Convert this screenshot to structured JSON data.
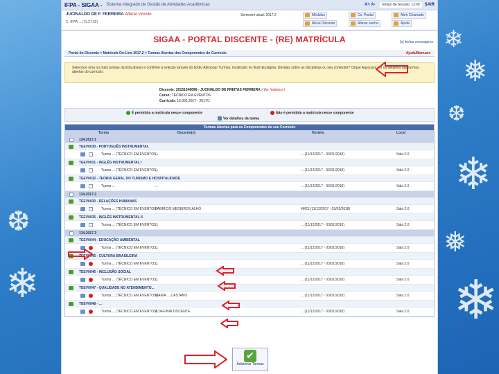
{
  "topbar": {
    "app_name": "IFPA - SIGAA -",
    "system_name": "Sistema Integrado de Gestão de Atividades Acadêmicas",
    "font_controls": "A+ A-",
    "session_timer": "Tempo de Sessão: 1x:00",
    "logout": "SAIR",
    "user_name": "JUCINALDO DE F. FERREIRA",
    "change_link": "Alterar vínculo",
    "user_sub": "C. IFPA ... (11.27.02)",
    "semester": "Semestre atual: 2017.2"
  },
  "toolbar": {
    "modules": "Módulos",
    "inbox": "Cx. Postal",
    "support": "Abrir Chamado",
    "menu": "Menu Discente",
    "password": "Alterar senha",
    "help": "Ajuda"
  },
  "heading": "SIGAA - PORTAL DISCENTE - (RE) MATRÍCULA",
  "close_messages": "[x] fechar mensagens",
  "breadcrumb": "Portal do Discente > Matrícula On-Line 2017.2 > Turmas Abertas dos Componentes do Currículo",
  "help_manual": "Ajuda/Manuais",
  "instructions": "Selecione uma ou mais turmas da lista abaixo e confirme a seleção através do botão Adicionar Turmas, localizado no final da página. Dúvidas sobre as disciplinas ou seu conteúdo? Clique Aqui para ver os detalhes das turmas abertas do currículo.",
  "student": {
    "label": "Discente:",
    "value": "20151346696 - JUCINALDO DE FREITAS FERREIRA",
    "note": "( Ver histórico )",
    "course_label": "Curso:",
    "course": "TÉCNICO EM EVENTOS",
    "curriculum_label": "Currículo:",
    "curriculum": "15.001.2017 - 2017/1"
  },
  "legend": {
    "allowed": "É permitido a matrícula nesse componente",
    "not_allowed": "Não é permitido a matrícula nesse componente",
    "details": "Ver detalhes da turma",
    "allowed_color": "#3a9a2c",
    "not_allowed_color": "#d02020"
  },
  "table": {
    "title": "Turmas Abertas para os Componentes do seu Currículo",
    "headers": [
      "Turma",
      "Docente(s)",
      "Horário",
      "Local"
    ],
    "rows": [
      {
        "type": "period",
        "text": "134.2017.1"
      },
      {
        "type": "discipline",
        "text": "TEEV0030 - PORTUGUÊS INSTRUMENTAL"
      },
      {
        "type": "class",
        "turma": "Turma ... (TÉCNICO EM EVENTOS)",
        "docente": "...",
        "horario": "... (11/12/2017 - 03/01/2018)",
        "local": "Sala 2.0",
        "allowed": true
      },
      {
        "type": "discipline",
        "text": "TEEV0031 - INGLÊS INSTRUMENTAL I"
      },
      {
        "type": "class",
        "turma": "Turma ... (TÉCNICO EM EVENTOS)",
        "docente": "...",
        "horario": "... (11/12/2017 - 03/01/2018)",
        "local": "Sala 2.0",
        "allowed": true
      },
      {
        "type": "discipline",
        "text": "TEEV0032 - TEORIA GERAL DO TURISMO E HOSPITALIDADE"
      },
      {
        "type": "class",
        "turma": "Turma ...",
        "docente": "...",
        "horario": "... (11/12/2017 - 03/01/2018)",
        "local": "Sala 2.0",
        "allowed": true
      },
      {
        "type": "period",
        "text": "134.2017.2"
      },
      {
        "type": "discipline",
        "text": "TEEV0030 - RELAÇÕES HUMANAS"
      },
      {
        "type": "class",
        "turma": "Turma ... (TÉCNICO EM EVENTOS)",
        "docente": "FABRÍCIO MEDEIROS ALHO",
        "horario": "4M23 (11/12/2017 - 03/01/2018)",
        "local": "Sala 2.0",
        "allowed": true
      },
      {
        "type": "discipline",
        "text": "TEEV0035 - INGLÊS INSTRUMENTAL II"
      },
      {
        "type": "class",
        "turma": "Turma ... (TÉCNICO EM EVENTOS)",
        "docente": "...",
        "horario": "... (11/12/2017 - 03/01/2018)",
        "local": "Sala 2.0",
        "allowed": true
      },
      {
        "type": "period",
        "text": "134.2017.3"
      },
      {
        "type": "discipline",
        "text": "TEEV0044 - EDUCAÇÃO AMBIENTAL"
      },
      {
        "type": "class",
        "turma": "Turma ... (TÉCNICO EM EVENTOS)",
        "docente": "...",
        "horario": "... (11/12/2017 - 03/01/2018)",
        "local": "Sala 2.0",
        "allowed": false
      },
      {
        "type": "discipline",
        "text": "TEEV0045 - CULTURA BRASILEIRA"
      },
      {
        "type": "class",
        "turma": "Turma ... (TÉCNICO EM EVENTOS)",
        "docente": "...",
        "horario": "... (11/12/2017 - 03/01/2018)",
        "local": "Sala 2.0",
        "allowed": false
      },
      {
        "type": "discipline",
        "text": "TEEV0046 - INCLUSÃO SOCIAL"
      },
      {
        "type": "class",
        "turma": "Turma ... (TÉCNICO EM EVENTOS)",
        "docente": "...",
        "horario": "... (11/12/2017 - 03/01/2018)",
        "local": "Sala 2.0",
        "allowed": false
      },
      {
        "type": "discipline",
        "text": "TEEV0047 - QUALIDADE NO ATENDIMENTO..."
      },
      {
        "type": "class",
        "turma": "Turma ... (TÉCNICO EM EVENTOS)",
        "docente": "MARIA ... CASTANO",
        "horario": "... (11/12/2017 - 03/01/2018)",
        "local": "Sala 2.0",
        "allowed": false
      },
      {
        "type": "discipline",
        "text": "TEEV0048 - ..."
      },
      {
        "type": "class",
        "turma": "Turma ... (TÉCNICO EM EVENTOS)",
        "docente": "A DEFINIR DOCENTE",
        "horario": "... (11/12/2017 - 03/01/2018)",
        "local": "Sala 2.0",
        "allowed": false
      }
    ]
  },
  "add_button": "Adicionar Turmas",
  "arrow_color": "#e0202a"
}
